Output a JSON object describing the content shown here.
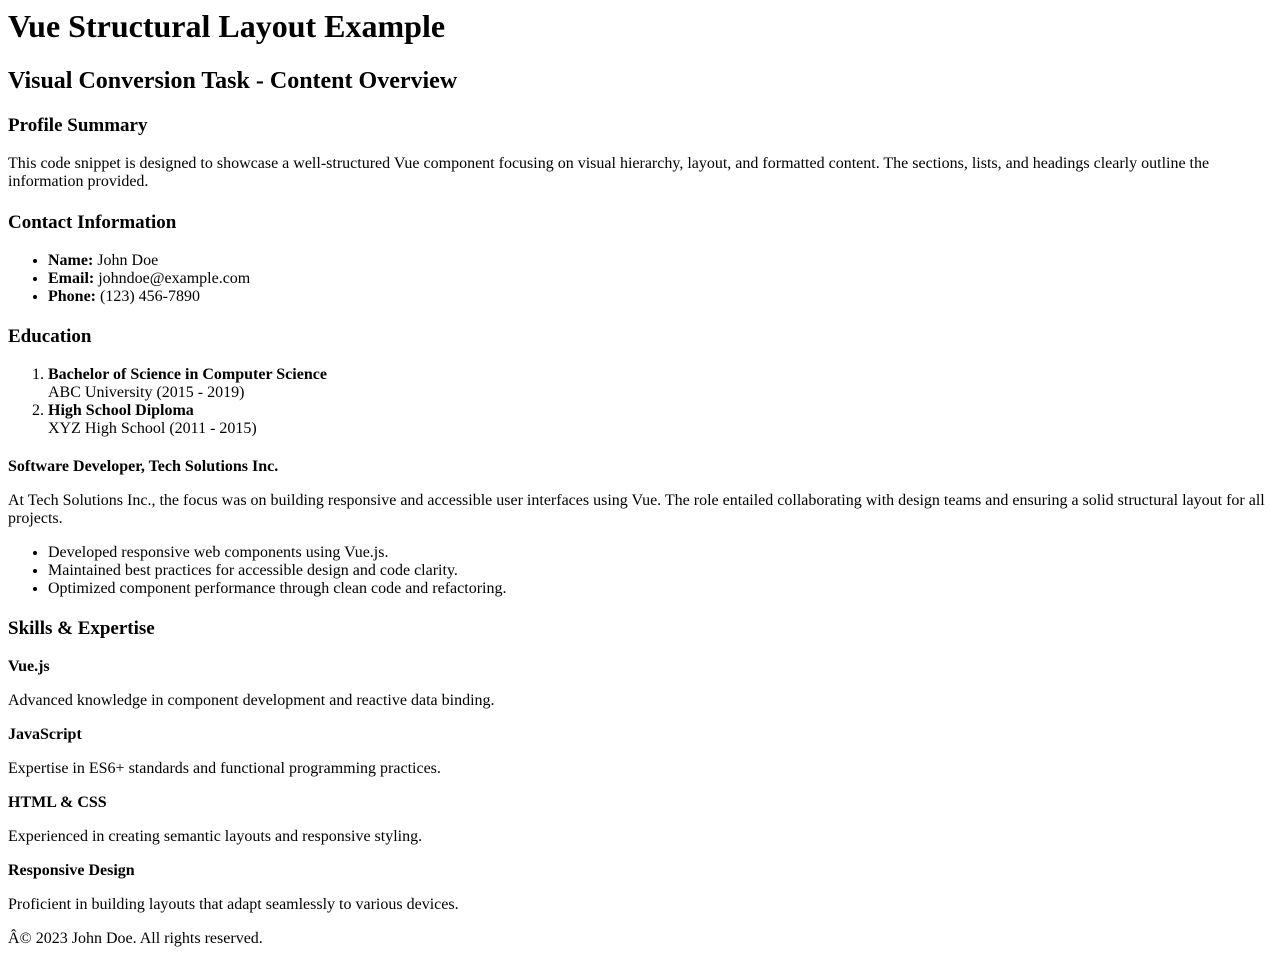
{
  "page": {
    "title": "Vue Structural Layout Example",
    "subtitle": "Visual Conversion Task - Content Overview"
  },
  "profile": {
    "heading": "Profile Summary",
    "text": "This code snippet is designed to showcase a well-structured Vue component focusing on visual hierarchy, layout, and formatted content. The sections, lists, and headings clearly outline the information provided."
  },
  "contact": {
    "heading": "Contact Information",
    "items": [
      {
        "label": "Name:",
        "value": "John Doe"
      },
      {
        "label": "Email:",
        "value": "johndoe@example.com"
      },
      {
        "label": "Phone:",
        "value": "(123) 456-7890"
      }
    ]
  },
  "education": {
    "heading": "Education",
    "items": [
      {
        "title": "Bachelor of Science in Computer Science",
        "detail": "ABC University (2015 - 2019)"
      },
      {
        "title": "High School Diploma",
        "detail": "XYZ High School (2011 - 2015)"
      }
    ]
  },
  "experience": {
    "role": "Software Developer, Tech Solutions Inc.",
    "description": "At Tech Solutions Inc., the focus was on building responsive and accessible user interfaces using Vue. The role entailed collaborating with design teams and ensuring a solid structural layout for all projects.",
    "bullets": [
      "Developed responsive web components using Vue.js.",
      "Maintained best practices for accessible design and code clarity.",
      "Optimized component performance through clean code and refactoring."
    ]
  },
  "skills": {
    "heading": "Skills & Expertise",
    "items": [
      {
        "name": "Vue.js",
        "description": "Advanced knowledge in component development and reactive data binding."
      },
      {
        "name": "JavaScript",
        "description": "Expertise in ES6+ standards and functional programming practices."
      },
      {
        "name": "HTML & CSS",
        "description": "Experienced in creating semantic layouts and responsive styling."
      },
      {
        "name": "Responsive Design",
        "description": "Proficient in building layouts that adapt seamlessly to various devices."
      }
    ]
  },
  "footer": {
    "text": "Â© 2023 John Doe. All rights reserved."
  }
}
